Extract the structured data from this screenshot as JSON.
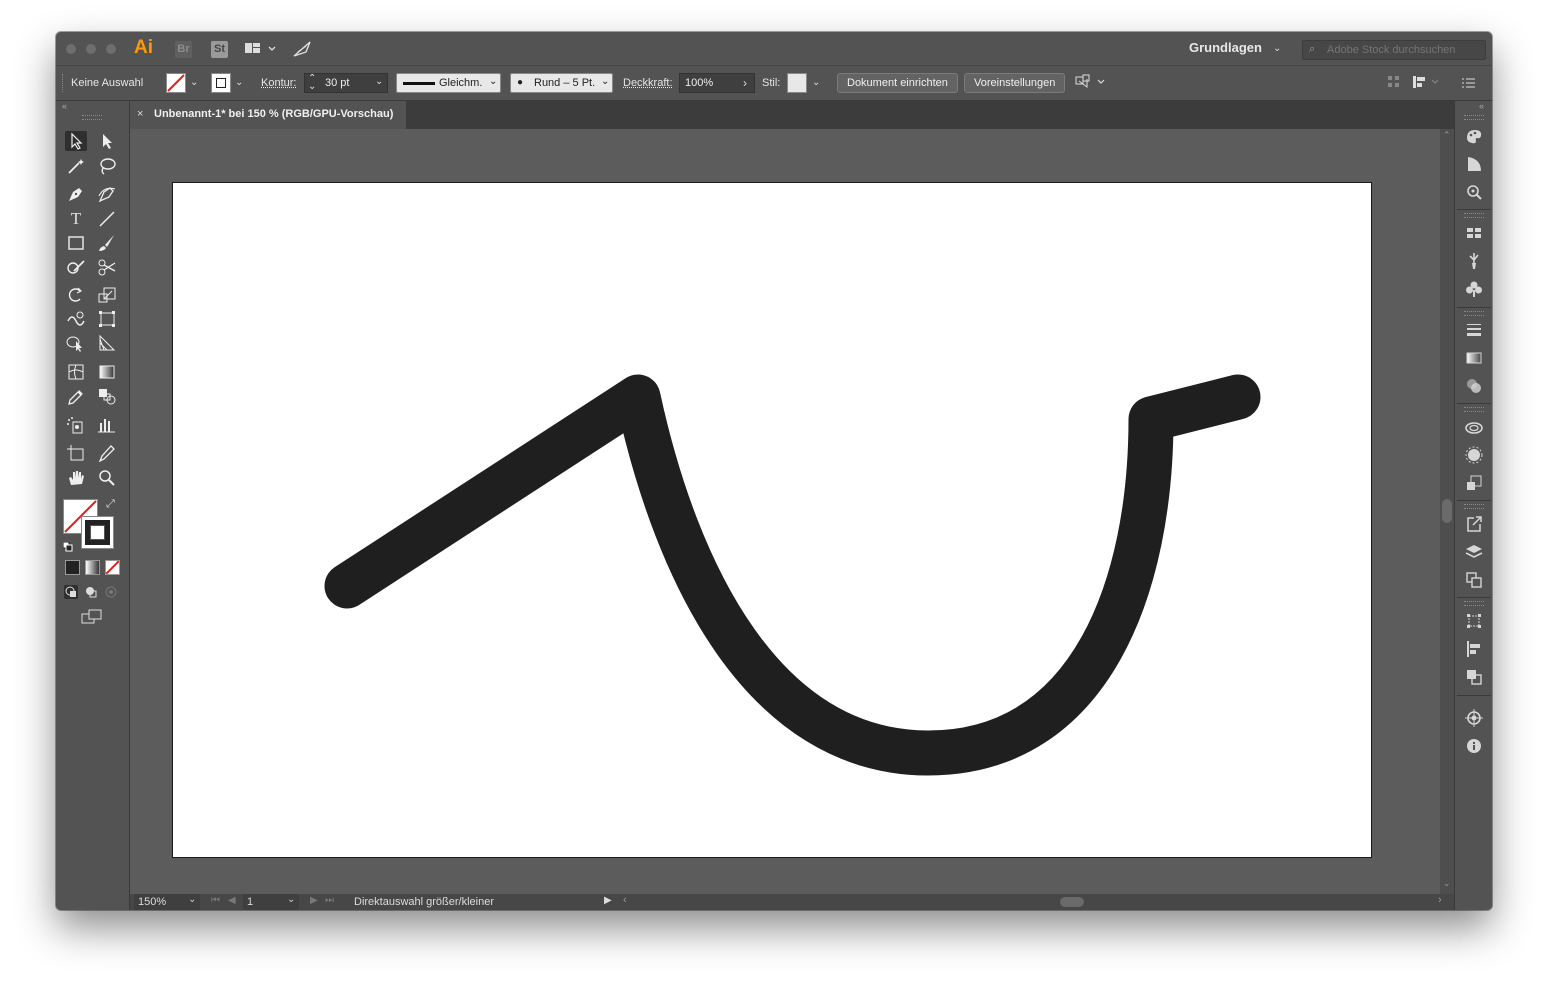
{
  "app": {
    "logo": "Ai",
    "bridge_icon": "Br",
    "stock_icon": "St",
    "workspace": "Grundlagen",
    "stock_search_placeholder": "Adobe Stock durchsuchen"
  },
  "controlbar": {
    "selection": "Keine Auswahl",
    "kontur_label": "Kontur:",
    "kontur_value": "30 pt",
    "stroke_profile": "Gleichm.",
    "brush": "Rund – 5 Pt.",
    "opacity_label": "Deckkraft:",
    "opacity_value": "100%",
    "style_label": "Stil:",
    "doc_setup_button": "Dokument einrichten",
    "prefs_button": "Voreinstellungen"
  },
  "document": {
    "tab_title": "Unbenannt-1* bei 150 % (RGB/GPU-Vorschau)",
    "close_glyph": "×"
  },
  "statusbar": {
    "zoom": "150%",
    "artboard_number": "1",
    "status_text": "Direktauswahl größer/kleiner"
  },
  "colors": {
    "ui_bg": "#535353",
    "canvas_bg": "#5c5c5c",
    "stroke": "#1f1f1f",
    "brand": "#ff9a00"
  }
}
